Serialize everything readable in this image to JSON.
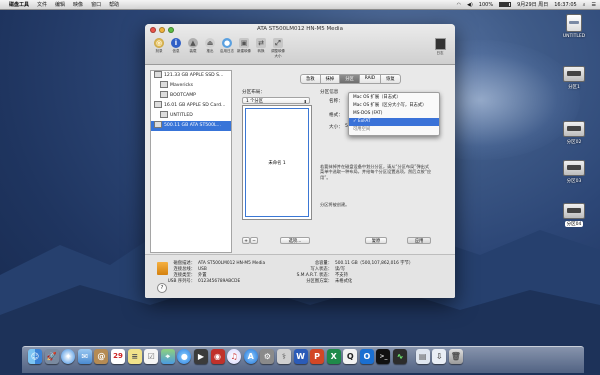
{
  "menubar": {
    "apple": "",
    "items": [
      "磁盘工具",
      "文件",
      "编辑",
      "映像",
      "窗口",
      "帮助"
    ],
    "status": {
      "battery": "100%",
      "datetime": "9月29日 周日",
      "time": "16:37:05"
    }
  },
  "desktop": {
    "icons": [
      {
        "label": "UNTITLED",
        "selected": false
      },
      {
        "label": "分区1",
        "selected": false
      },
      {
        "label": "分区02",
        "selected": false
      },
      {
        "label": "分区03",
        "selected": false
      },
      {
        "label": "分区04",
        "selected": true
      }
    ]
  },
  "window": {
    "title": "ATA ST500LM012 HN-M5 Media",
    "toolbar": [
      "刻录",
      "信息",
      "装载",
      "推出",
      "启用日志",
      "新建映像",
      "转换",
      "调整映像大小"
    ],
    "log_label": "日志",
    "sidebar": [
      {
        "label": "121.33 GB APPLE SSD S...",
        "level": 0,
        "selected": false
      },
      {
        "label": "Mavericks",
        "level": 1,
        "selected": false
      },
      {
        "label": "BOOTCAMP",
        "level": 1,
        "selected": false
      },
      {
        "label": "16.01 GB APPLE SD Card...",
        "level": 0,
        "selected": false
      },
      {
        "label": "UNTITLED",
        "level": 1,
        "selected": false
      },
      {
        "label": "500.11 GB ATA ST500L...",
        "level": 0,
        "selected": true
      }
    ],
    "tabs": [
      "急救",
      "抹掉",
      "分区",
      "RAID",
      "恢复"
    ],
    "selected_tab": "分区",
    "partition": {
      "layout_label": "分区布局：",
      "layout_value": "1 个分区",
      "info_label": "分区信息",
      "name_label": "名称：",
      "format_label": "格式：",
      "size_label": "大小：",
      "size_value": "500.11",
      "size_unit": "GB",
      "partition_name": "未命名 1",
      "description": "若要抹掉并在磁盘设备中划分分区，请从“分区布局”弹出式菜单中选取一种布局，并给每个分区设置选项，然后点按“应用”。",
      "note": "分区将被创建。",
      "options_button": "选项...",
      "revert_button": "复原",
      "apply_button": "应用",
      "add": "+",
      "remove": "−"
    },
    "format_menu": {
      "options": [
        "Mac OS 扩展（日志式）",
        "Mac OS 扩展（区分大小写，日志式）",
        "MS-DOS (FAT)",
        "ExFAT",
        "可用空间"
      ],
      "selected": "ExFAT",
      "checkmark": "✓"
    },
    "info": {
      "left": [
        {
          "key": "磁盘描述：",
          "value": "ATA ST500LM012 HN-M5 Media"
        },
        {
          "key": "连接总线：",
          "value": "USB"
        },
        {
          "key": "连接类型：",
          "value": "外置"
        },
        {
          "key": "USB 序列号：",
          "value": "0123456789ABCDE"
        }
      ],
      "right": [
        {
          "key": "总容量：",
          "value": "500.11 GB（500,107,862,016 字节）"
        },
        {
          "key": "写入状态：",
          "value": "读/写"
        },
        {
          "key": "S.M.A.R.T. 状态：",
          "value": "不支持"
        },
        {
          "key": "分区图方案：",
          "value": "未格式化"
        }
      ],
      "help": "?"
    }
  },
  "dock": {
    "apps": [
      "Finder",
      "Launchpad",
      "Safari",
      "Mail",
      "Contacts",
      "Calendar",
      "Notes",
      "Reminders",
      "Maps",
      "Messages",
      "FaceTime",
      "Photo Booth",
      "iTunes",
      "App Store",
      "System Preferences",
      "Disk Utility",
      "Word",
      "PowerPoint",
      "Excel",
      "QQ",
      "Outlook",
      "Terminal",
      "Activity Monitor",
      "Preview",
      "Downloads",
      "Trash"
    ],
    "calendar_day": "29"
  },
  "colors": {
    "selection": "#3874d8",
    "accent": "#3a72d8"
  }
}
